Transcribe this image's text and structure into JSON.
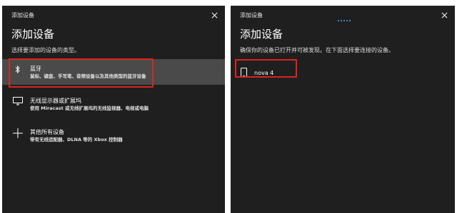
{
  "left": {
    "window_title": "添加设备",
    "heading": "添加设备",
    "subtitle": "选择要添加的设备的类型。",
    "options": [
      {
        "title": "蓝牙",
        "desc": "鼠标、键盘、手写笔、音频设备以及其他类型的蓝牙设备",
        "icon": "bluetooth-icon"
      },
      {
        "title": "无线显示器或扩展坞",
        "desc": "使用 Miracast 或无线扩展坞的无线监视器、电视或电脑",
        "icon": "monitor-icon"
      },
      {
        "title": "其他所有设备",
        "desc": "带有无线适配器、DLNA 等的 Xbox 控制器",
        "icon": "plus-icon"
      }
    ]
  },
  "right": {
    "window_title": "添加设备",
    "heading": "添加设备",
    "subtitle": "确保你的设备已打开并可被发现。在下面选择要连接的设备。",
    "devices": [
      {
        "name": "nova 4",
        "icon": "phone-icon"
      }
    ]
  },
  "colors": {
    "background": "#1f1f1f",
    "selected": "#4a4a4a",
    "highlight_border": "#d9261c",
    "progress_dots": "#4aa3ff"
  }
}
